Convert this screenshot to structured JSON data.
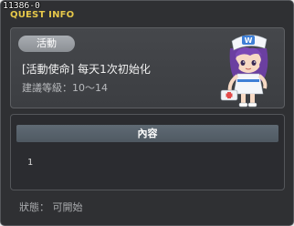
{
  "window": {
    "quest_id": "11386-0",
    "title": "QUEST INFO"
  },
  "quest": {
    "category": "活動",
    "title": "[活動使命] 每天1次初始化",
    "level_label": "建議等級：",
    "level_range": "10～14"
  },
  "content": {
    "header": "內容",
    "body": "1"
  },
  "status": {
    "text": "狀態： 可開始"
  },
  "colors": {
    "title_accent": "#e6c84a",
    "panel_bg": "#2f3033"
  },
  "icons": {
    "npc": "nurse-npc-portrait"
  }
}
